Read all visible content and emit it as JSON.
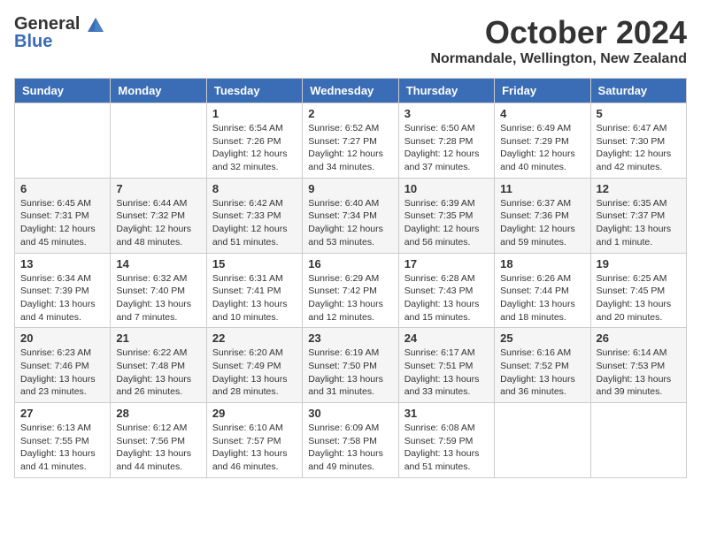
{
  "header": {
    "logo": {
      "text_general": "General",
      "text_blue": "Blue"
    },
    "title": "October 2024",
    "location": "Normandale, Wellington, New Zealand"
  },
  "calendar": {
    "weekdays": [
      "Sunday",
      "Monday",
      "Tuesday",
      "Wednesday",
      "Thursday",
      "Friday",
      "Saturday"
    ],
    "weeks": [
      [
        {
          "day": "",
          "info": ""
        },
        {
          "day": "",
          "info": ""
        },
        {
          "day": "1",
          "info": "Sunrise: 6:54 AM\nSunset: 7:26 PM\nDaylight: 12 hours and 32 minutes."
        },
        {
          "day": "2",
          "info": "Sunrise: 6:52 AM\nSunset: 7:27 PM\nDaylight: 12 hours and 34 minutes."
        },
        {
          "day": "3",
          "info": "Sunrise: 6:50 AM\nSunset: 7:28 PM\nDaylight: 12 hours and 37 minutes."
        },
        {
          "day": "4",
          "info": "Sunrise: 6:49 AM\nSunset: 7:29 PM\nDaylight: 12 hours and 40 minutes."
        },
        {
          "day": "5",
          "info": "Sunrise: 6:47 AM\nSunset: 7:30 PM\nDaylight: 12 hours and 42 minutes."
        }
      ],
      [
        {
          "day": "6",
          "info": "Sunrise: 6:45 AM\nSunset: 7:31 PM\nDaylight: 12 hours and 45 minutes."
        },
        {
          "day": "7",
          "info": "Sunrise: 6:44 AM\nSunset: 7:32 PM\nDaylight: 12 hours and 48 minutes."
        },
        {
          "day": "8",
          "info": "Sunrise: 6:42 AM\nSunset: 7:33 PM\nDaylight: 12 hours and 51 minutes."
        },
        {
          "day": "9",
          "info": "Sunrise: 6:40 AM\nSunset: 7:34 PM\nDaylight: 12 hours and 53 minutes."
        },
        {
          "day": "10",
          "info": "Sunrise: 6:39 AM\nSunset: 7:35 PM\nDaylight: 12 hours and 56 minutes."
        },
        {
          "day": "11",
          "info": "Sunrise: 6:37 AM\nSunset: 7:36 PM\nDaylight: 12 hours and 59 minutes."
        },
        {
          "day": "12",
          "info": "Sunrise: 6:35 AM\nSunset: 7:37 PM\nDaylight: 13 hours and 1 minute."
        }
      ],
      [
        {
          "day": "13",
          "info": "Sunrise: 6:34 AM\nSunset: 7:39 PM\nDaylight: 13 hours and 4 minutes."
        },
        {
          "day": "14",
          "info": "Sunrise: 6:32 AM\nSunset: 7:40 PM\nDaylight: 13 hours and 7 minutes."
        },
        {
          "day": "15",
          "info": "Sunrise: 6:31 AM\nSunset: 7:41 PM\nDaylight: 13 hours and 10 minutes."
        },
        {
          "day": "16",
          "info": "Sunrise: 6:29 AM\nSunset: 7:42 PM\nDaylight: 13 hours and 12 minutes."
        },
        {
          "day": "17",
          "info": "Sunrise: 6:28 AM\nSunset: 7:43 PM\nDaylight: 13 hours and 15 minutes."
        },
        {
          "day": "18",
          "info": "Sunrise: 6:26 AM\nSunset: 7:44 PM\nDaylight: 13 hours and 18 minutes."
        },
        {
          "day": "19",
          "info": "Sunrise: 6:25 AM\nSunset: 7:45 PM\nDaylight: 13 hours and 20 minutes."
        }
      ],
      [
        {
          "day": "20",
          "info": "Sunrise: 6:23 AM\nSunset: 7:46 PM\nDaylight: 13 hours and 23 minutes."
        },
        {
          "day": "21",
          "info": "Sunrise: 6:22 AM\nSunset: 7:48 PM\nDaylight: 13 hours and 26 minutes."
        },
        {
          "day": "22",
          "info": "Sunrise: 6:20 AM\nSunset: 7:49 PM\nDaylight: 13 hours and 28 minutes."
        },
        {
          "day": "23",
          "info": "Sunrise: 6:19 AM\nSunset: 7:50 PM\nDaylight: 13 hours and 31 minutes."
        },
        {
          "day": "24",
          "info": "Sunrise: 6:17 AM\nSunset: 7:51 PM\nDaylight: 13 hours and 33 minutes."
        },
        {
          "day": "25",
          "info": "Sunrise: 6:16 AM\nSunset: 7:52 PM\nDaylight: 13 hours and 36 minutes."
        },
        {
          "day": "26",
          "info": "Sunrise: 6:14 AM\nSunset: 7:53 PM\nDaylight: 13 hours and 39 minutes."
        }
      ],
      [
        {
          "day": "27",
          "info": "Sunrise: 6:13 AM\nSunset: 7:55 PM\nDaylight: 13 hours and 41 minutes."
        },
        {
          "day": "28",
          "info": "Sunrise: 6:12 AM\nSunset: 7:56 PM\nDaylight: 13 hours and 44 minutes."
        },
        {
          "day": "29",
          "info": "Sunrise: 6:10 AM\nSunset: 7:57 PM\nDaylight: 13 hours and 46 minutes."
        },
        {
          "day": "30",
          "info": "Sunrise: 6:09 AM\nSunset: 7:58 PM\nDaylight: 13 hours and 49 minutes."
        },
        {
          "day": "31",
          "info": "Sunrise: 6:08 AM\nSunset: 7:59 PM\nDaylight: 13 hours and 51 minutes."
        },
        {
          "day": "",
          "info": ""
        },
        {
          "day": "",
          "info": ""
        }
      ]
    ]
  }
}
